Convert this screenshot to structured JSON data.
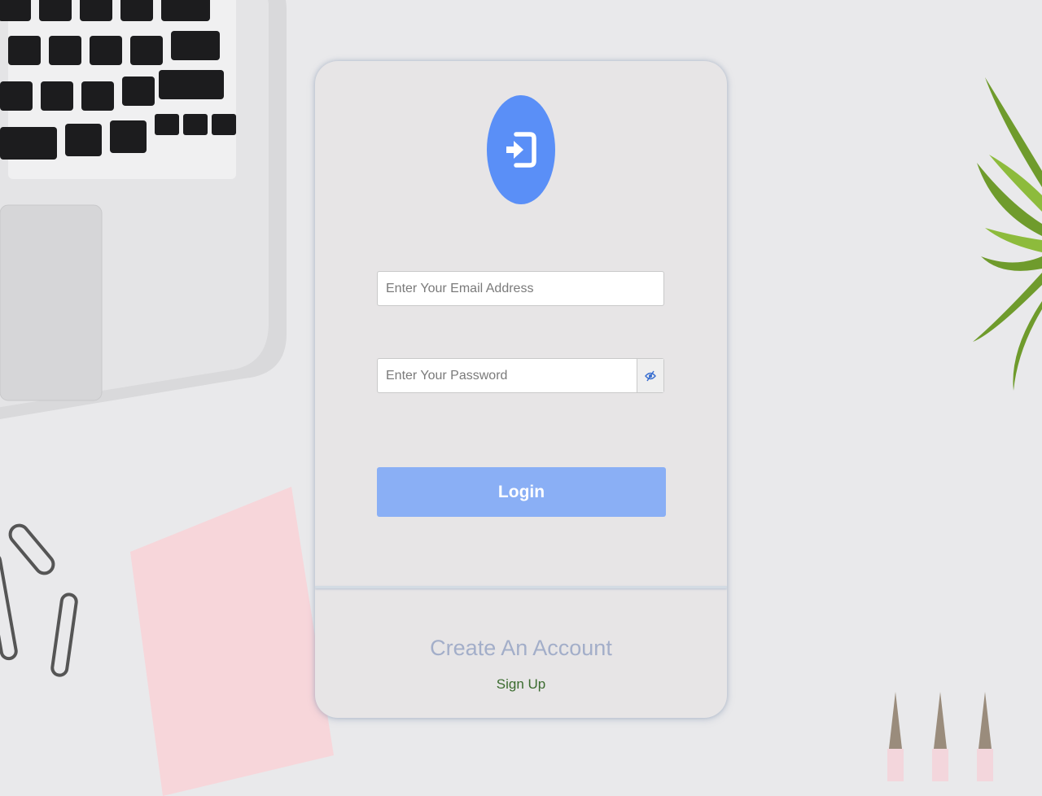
{
  "colors": {
    "accent": "#5a8ff7",
    "button": "#8aaff5",
    "footer_title": "#a3aec9",
    "signup_link": "#3b6b2f",
    "card_background": "#e7e5e6",
    "page_background": "#e9e9eb"
  },
  "header": {
    "icon": "login-icon"
  },
  "form": {
    "email_placeholder": "Enter Your Email Address",
    "email_value": "",
    "password_placeholder": "Enter Your Password",
    "password_value": "",
    "password_toggle_icon": "eye-slash-icon",
    "login_label": "Login"
  },
  "footer": {
    "title": "Create An Account",
    "signup_label": "Sign Up"
  }
}
